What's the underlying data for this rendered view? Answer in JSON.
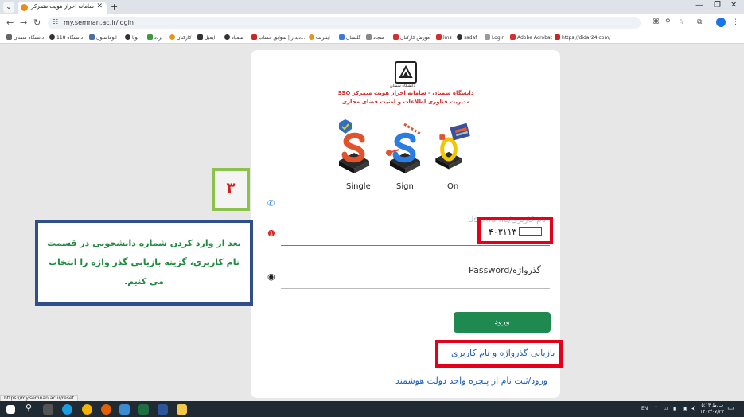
{
  "browser": {
    "tab_title": "سامانه احراز هویت متمرکز SSO -",
    "url": "my.semnan.ac.ir/login",
    "bookmarks": [
      "دانشگاه سمنان",
      "118 دانشگاه",
      "اتوماسیون",
      "پویا",
      "تردد",
      "کارکنان",
      "ایمیل",
      "سمیاد",
      "دیدار | سوابق حساب...",
      "اینترنت",
      "گلستان",
      "سجاد",
      "آموزش کارکنان",
      "lms",
      "sadaf",
      "Login",
      "Adobe Acrobat",
      "https://didar24.com/"
    ]
  },
  "card": {
    "logo_caption": "دانشگاه سمنان",
    "org_line1": "دانشگاه سمنان - سامانه احراز هویت متمرکز SSO",
    "org_line2": "مدیریت فناوری اطلاعات و امنیت فضای مجازی",
    "sso_labels": [
      "Single",
      "Sign",
      "On"
    ],
    "username_label": "Username/نام کاربری",
    "username_value": "۴۰۳۱۱۳",
    "password_label": "Password/گذرواژه",
    "login_button": "ورود",
    "reset_link": "بازیابی گذرواژه و نام کاربری",
    "gov_link": "ورود/ثبت نام از پنجره واحد دولت هوشمند"
  },
  "annotation": {
    "step_number": "۳",
    "note": "بعد از وارد کردن شماره دانشجویی در قسمت نام کاربری، گزینه بازیابی گذر واژه را انتخاب می کنیم."
  },
  "status_url": "https://my.semnan.ac.ir/reset",
  "taskbar": {
    "language": "EN",
    "time": "۵:۱۳ ب.ظ",
    "date": "۱۴۰۳/۰۷/۲۳"
  }
}
